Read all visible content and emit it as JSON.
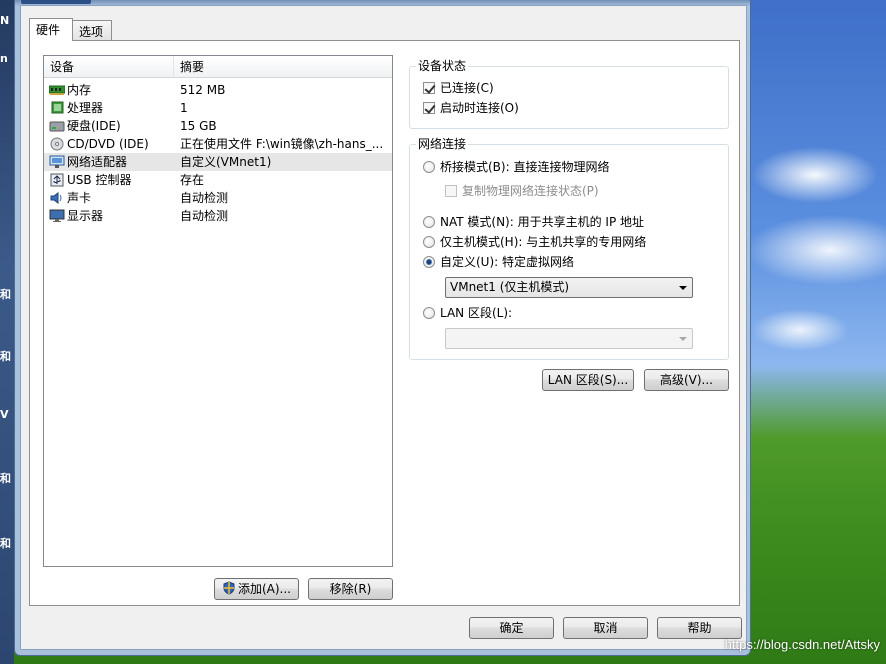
{
  "tabs": [
    {
      "label": "硬件",
      "active": true
    },
    {
      "label": "选项",
      "active": false
    }
  ],
  "device_list": {
    "columns": [
      "设备",
      "摘要"
    ],
    "rows": [
      {
        "icon": "memory-icon",
        "name": "内存",
        "summary": "512 MB",
        "selected": false
      },
      {
        "icon": "processor-icon",
        "name": "处理器",
        "summary": "1",
        "selected": false
      },
      {
        "icon": "hard-disk-icon",
        "name": "硬盘(IDE)",
        "summary": "15 GB",
        "selected": false
      },
      {
        "icon": "cd-dvd-icon",
        "name": "CD/DVD (IDE)",
        "summary": "正在使用文件 F:\\win镜像\\zh-hans_...",
        "selected": false
      },
      {
        "icon": "network-adapter-icon",
        "name": "网络适配器",
        "summary": "自定义(VMnet1)",
        "selected": true
      },
      {
        "icon": "usb-icon",
        "name": "USB 控制器",
        "summary": "存在",
        "selected": false
      },
      {
        "icon": "sound-card-icon",
        "name": "声卡",
        "summary": "自动检测",
        "selected": false
      },
      {
        "icon": "display-icon",
        "name": "显示器",
        "summary": "自动检测",
        "selected": false
      }
    ]
  },
  "buttons": {
    "add": "添加(A)...",
    "remove": "移除(R)",
    "lan_segments": "LAN 区段(S)...",
    "advanced": "高级(V)...",
    "ok": "确定",
    "cancel": "取消",
    "help": "帮助"
  },
  "device_status": {
    "title": "设备状态",
    "connected": {
      "label": "已连接(C)",
      "checked": true
    },
    "connect_at_power_on": {
      "label": "启动时连接(O)",
      "checked": true
    }
  },
  "network_connection": {
    "title": "网络连接",
    "bridged": {
      "label": "桥接模式(B): 直接连接物理网络",
      "checked": false
    },
    "replicate": {
      "label": "复制物理网络连接状态(P)",
      "checked": false,
      "disabled": true
    },
    "nat": {
      "label": "NAT 模式(N): 用于共享主机的 IP 地址",
      "checked": false
    },
    "host_only": {
      "label": "仅主机模式(H): 与主机共享的专用网络",
      "checked": false
    },
    "custom": {
      "label": "自定义(U): 特定虚拟网络",
      "checked": true
    },
    "custom_value": "VMnet1 (仅主机模式)",
    "lan_segment": {
      "label": "LAN 区段(L):",
      "checked": false
    },
    "lan_segment_value": ""
  },
  "watermark": "https://blog.csdn.net/Attsky",
  "side_strip_chars": [
    "N",
    "n",
    "和",
    "和",
    "V",
    "和",
    "和"
  ]
}
